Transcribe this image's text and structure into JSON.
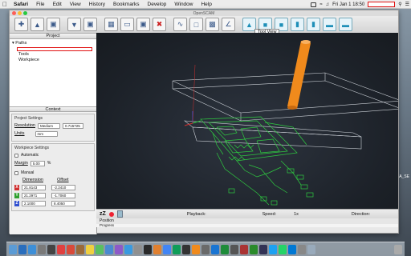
{
  "menubar": {
    "apple": "",
    "app_name": "Safari",
    "items": [
      "File",
      "Edit",
      "View",
      "History",
      "Bookmarks",
      "Develop",
      "Window",
      "Help"
    ],
    "clock": "Fri Jan 1  18:50"
  },
  "window": {
    "title": "OpenSCAM",
    "tool_view_label": "Tool View"
  },
  "left_panel": {
    "project_header": "Project",
    "tree": {
      "paths": "Paths",
      "tools": "Tools",
      "workpiece": "Workpiece"
    },
    "context_header": "Context",
    "project_settings": {
      "title": "Project Settings",
      "resolution_label": "Resolution",
      "resolution_value": "Medium",
      "resolution_number": "0.715725",
      "units_label": "Units",
      "units_value": "mm"
    },
    "workpiece_settings": {
      "title": "Workpiece Settings",
      "automatic_label": "Automatic",
      "margin_label": "Margin",
      "margin_value": "5.00",
      "margin_unit": "%",
      "manual_label": "Manual",
      "dimension_label": "Dimension",
      "offset_label": "Offset",
      "rows": [
        {
          "axis": "X",
          "color": "#d03030",
          "dimension": "21.8143",
          "offset": "-2.2410"
        },
        {
          "axis": "Y",
          "color": "#30a030",
          "dimension": "21.2971",
          "offset": "-1.7060"
        },
        {
          "axis": "Z",
          "color": "#3050d0",
          "dimension": "2.1000",
          "offset": "8.4050"
        }
      ]
    }
  },
  "playbar": {
    "zz": "zZ",
    "playback_label": "Playback:",
    "speed_label": "Speed:",
    "speed_value": "1x",
    "direction_label": "Direction:"
  },
  "status": {
    "position_label": "Position",
    "progress_label": "Progress"
  },
  "side_note": "A_SE",
  "colors": {
    "toolpath": "#2ecc40",
    "tool": "#f08a1c",
    "viewport_bg": "#1f242b",
    "highlight_red": "#e01010"
  }
}
